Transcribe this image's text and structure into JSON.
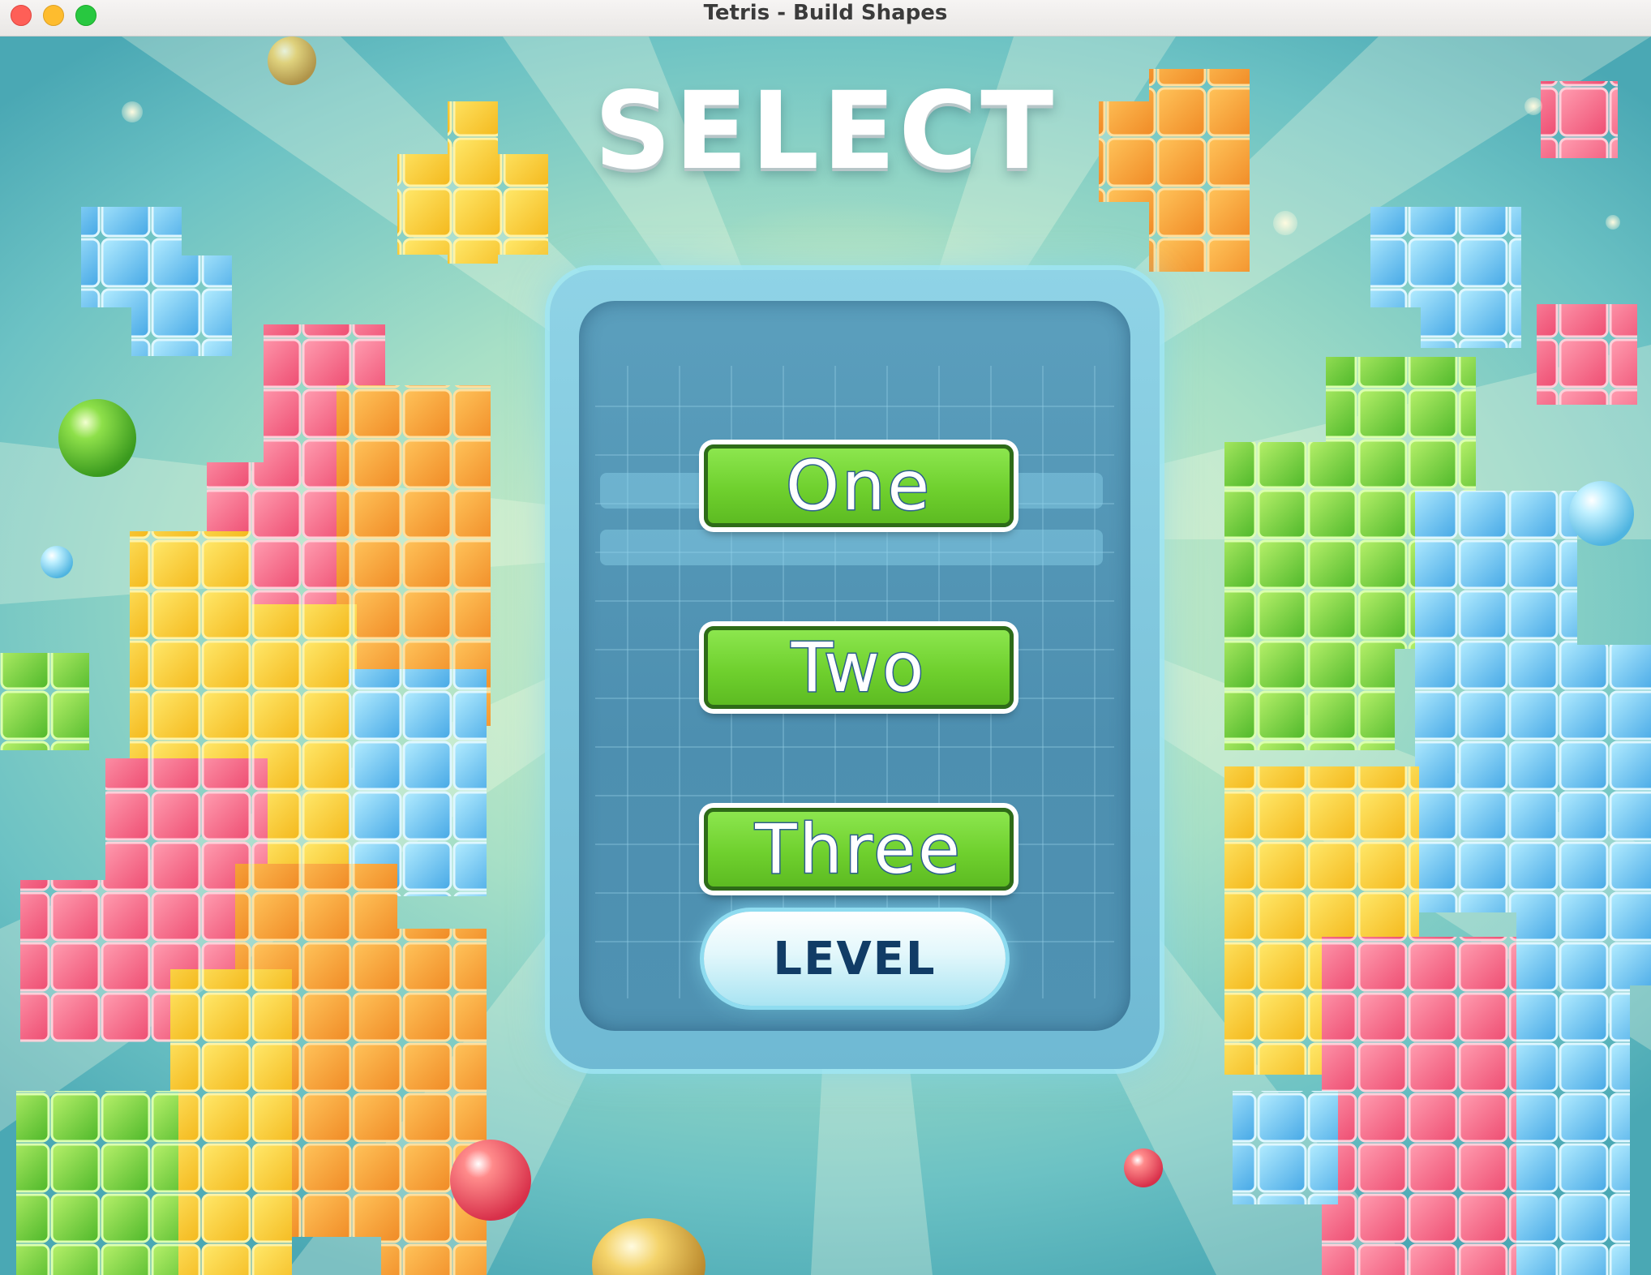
{
  "window": {
    "title": "Tetris - Build Shapes"
  },
  "screen": {
    "heading": "SELECT",
    "buttons": [
      {
        "label": "One"
      },
      {
        "label": "Two"
      },
      {
        "label": "Three"
      }
    ],
    "level_button": "LEVEL"
  },
  "colors": {
    "button_green": "#6fd02e",
    "button_text_outline": "#2d5f8e",
    "level_text": "#113c66",
    "panel_blue": "#5b9fbd"
  },
  "icons": [
    "close-icon",
    "minimize-icon",
    "maximize-icon"
  ]
}
